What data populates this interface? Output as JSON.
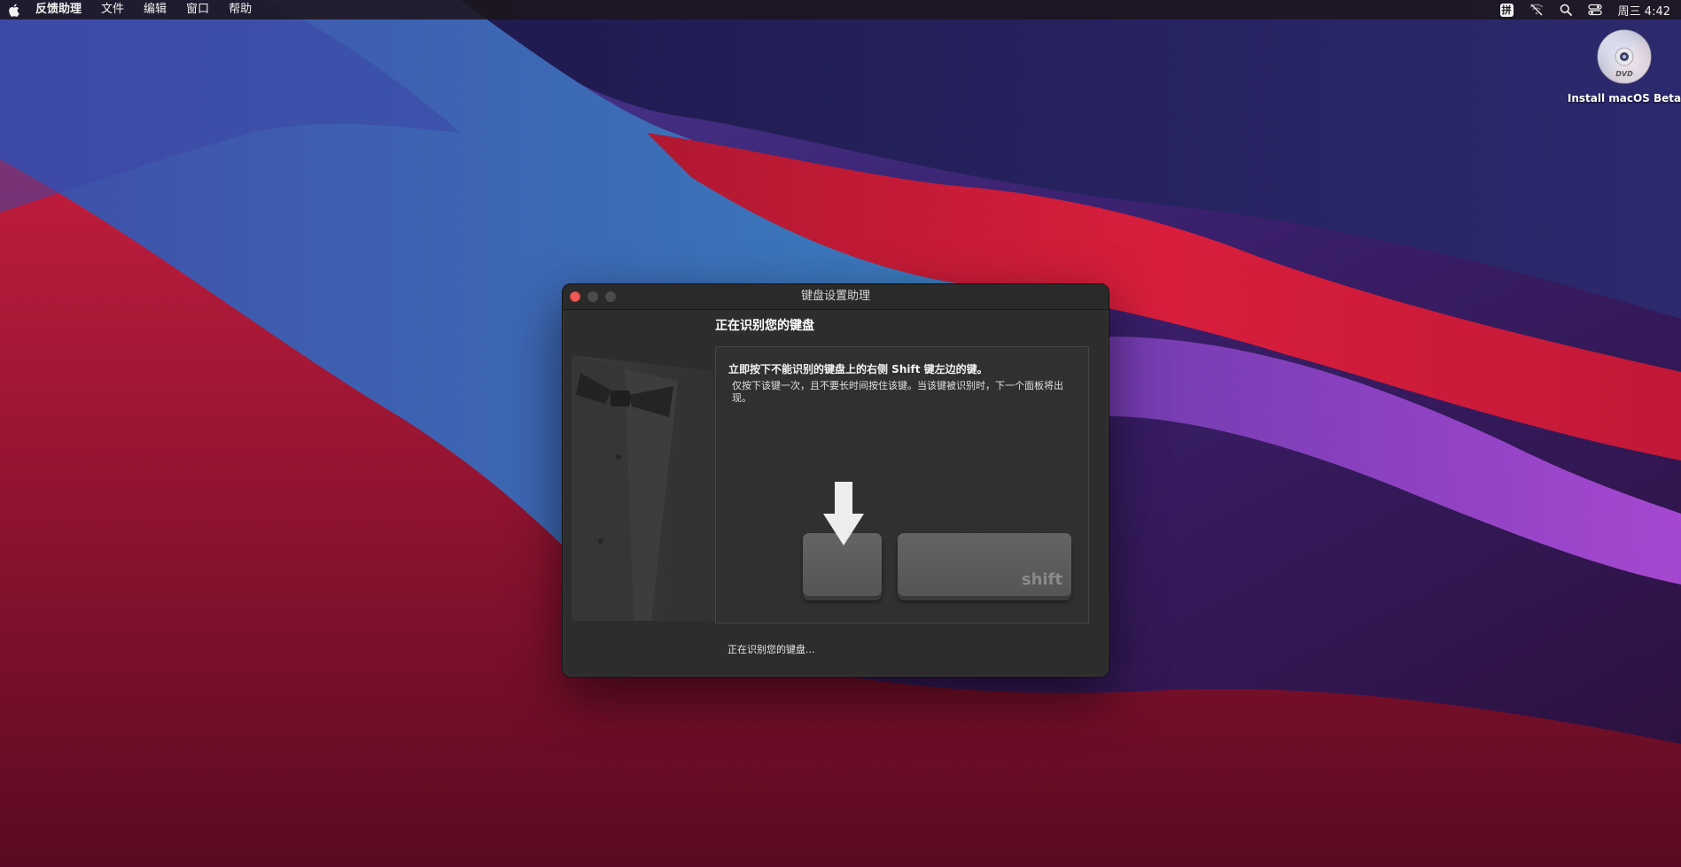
{
  "menubar": {
    "apple_icon": "apple-logo-icon",
    "app_name": "反馈助理",
    "items": [
      "文件",
      "编辑",
      "窗口",
      "帮助"
    ],
    "input_method": "拼",
    "status_icons": [
      "wifi-off-icon",
      "search-icon",
      "control-center-icon"
    ],
    "clock": "周三 4:42"
  },
  "desktop": {
    "icons": [
      {
        "label": "Install macOS Beta",
        "icon": "dvd-disc-icon"
      }
    ]
  },
  "window": {
    "title": "键盘设置助理",
    "controls": [
      "close",
      "minimize",
      "zoom"
    ],
    "heading": "正在识别您的键盘",
    "instruction": "立即按下不能识别的键盘上的右侧 Shift 键左边的键。",
    "instruction_detail": "仅按下该键一次，且不要长时间按住该键。当该键被识别时，下一个面板将出现。",
    "shift_key_label": "shift",
    "status": "正在识别您的键盘..."
  },
  "colors": {
    "close_button": "#ee5a55",
    "window_bg": "#2d2d2d",
    "panel_bg": "#303030"
  }
}
